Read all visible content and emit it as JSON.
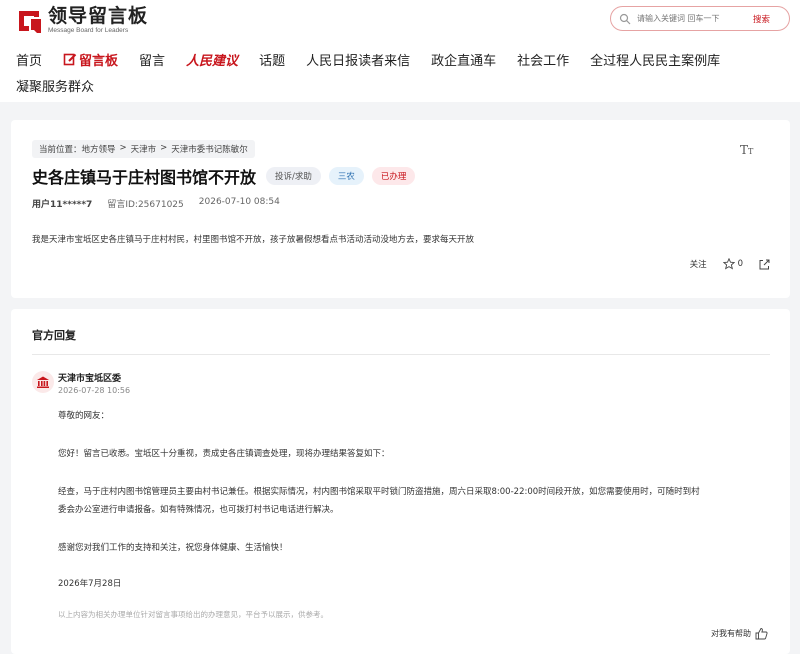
{
  "brand": {
    "name_cn": "领导留言板",
    "name_en": "Message Board for Leaders",
    "accent": "#c8161d"
  },
  "search": {
    "placeholder": "请输入关键词 回车一下",
    "button": "搜索"
  },
  "nav": {
    "row1": [
      "首页",
      "留言板",
      "留言",
      "人民建议",
      "话题",
      "人民日报读者来信",
      "政企直通车",
      "社会工作",
      "全过程人民民主案例库"
    ],
    "row2": [
      "凝聚服务群众"
    ]
  },
  "breadcrumb": {
    "prefix": "当前位置：",
    "items": [
      "地方领导",
      ">",
      "天津市",
      ">",
      "天津市委书记陈敏尔"
    ]
  },
  "message": {
    "title": "史各庄镇马于庄村图书馆不开放",
    "tags": [
      "投诉/求助",
      "三农",
      "已办理"
    ],
    "user": "用户11*****7",
    "id": "留言ID:25671025",
    "time": "2026-07-10 08:54",
    "body": "我是天津市宝坻区史各庄镇马于庄村村民，村里图书馆不开放，孩子放暑假想看点书活动活动没地方去，要求每天开放",
    "follow_label": "关注",
    "star_count": "0"
  },
  "reply": {
    "section_title": "官方回复",
    "org": "天津市宝坻区委",
    "date": "2026-07-28 10:56",
    "paragraphs": [
      "尊敬的网友：",
      "您好！留言已收悉。宝坻区十分重视，责成史各庄镇调查处理，现将办理结果答复如下：",
      "经查，马于庄村内图书馆管理员主要由村书记兼任。根据实际情况，村内图书馆采取平时锁门防盗措施，周六日采取8:00-22:00时间段开放，如您需要使用时，可随时到村",
      "委会办公室进行申请报备。如有特殊情况，也可拨打村书记电话进行解决。",
      "感谢您对我们工作的支持和关注，祝您身体健康、生活愉快！",
      "2026年7月28日"
    ],
    "disclaimer": "以上内容为相关办理单位针对留言事项给出的办理意见，平台予以展示，供参考。",
    "helpful_label": "对我有帮助"
  }
}
